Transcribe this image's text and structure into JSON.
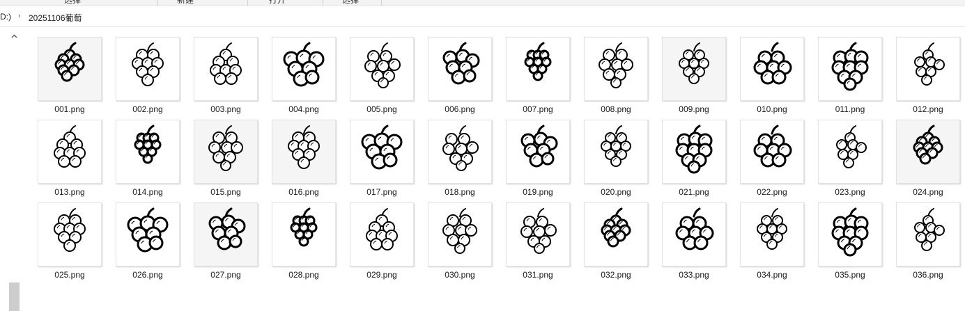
{
  "toolbar": {
    "buttons": [
      "选择",
      "新建",
      "打开",
      "选择"
    ]
  },
  "breadcrumb": {
    "drive": "D:)",
    "separator": "›",
    "folder": "20251106葡萄"
  },
  "files": [
    {
      "name": "001.png",
      "variant": 0
    },
    {
      "name": "002.png",
      "variant": 1
    },
    {
      "name": "003.png",
      "variant": 2
    },
    {
      "name": "004.png",
      "variant": 3
    },
    {
      "name": "005.png",
      "variant": 4
    },
    {
      "name": "006.png",
      "variant": 5
    },
    {
      "name": "007.png",
      "variant": 6
    },
    {
      "name": "008.png",
      "variant": 7
    },
    {
      "name": "009.png",
      "variant": 8
    },
    {
      "name": "010.png",
      "variant": 9
    },
    {
      "name": "011.png",
      "variant": 10
    },
    {
      "name": "012.png",
      "variant": 11
    },
    {
      "name": "013.png",
      "variant": 2
    },
    {
      "name": "014.png",
      "variant": 6
    },
    {
      "name": "015.png",
      "variant": 7
    },
    {
      "name": "016.png",
      "variant": 1
    },
    {
      "name": "017.png",
      "variant": 3
    },
    {
      "name": "018.png",
      "variant": 4
    },
    {
      "name": "019.png",
      "variant": 5
    },
    {
      "name": "020.png",
      "variant": 8
    },
    {
      "name": "021.png",
      "variant": 10
    },
    {
      "name": "022.png",
      "variant": 9
    },
    {
      "name": "023.png",
      "variant": 11
    },
    {
      "name": "024.png",
      "variant": 0
    },
    {
      "name": "025.png",
      "variant": 1
    },
    {
      "name": "026.png",
      "variant": 3
    },
    {
      "name": "027.png",
      "variant": 5
    },
    {
      "name": "028.png",
      "variant": 6
    },
    {
      "name": "029.png",
      "variant": 2
    },
    {
      "name": "030.png",
      "variant": 7
    },
    {
      "name": "031.png",
      "variant": 4
    },
    {
      "name": "032.png",
      "variant": 0
    },
    {
      "name": "033.png",
      "variant": 9
    },
    {
      "name": "034.png",
      "variant": 8
    },
    {
      "name": "035.png",
      "variant": 10
    },
    {
      "name": "036.png",
      "variant": 11
    }
  ],
  "icons": {
    "scroll_up": "chevron-up-icon",
    "thumbnail": "grape-bunch-icon"
  },
  "colors": {
    "background": "#ffffff",
    "toolbar": "#f3f3f3",
    "scroll_thumb": "#cdcdcd",
    "ink": "#000000"
  }
}
